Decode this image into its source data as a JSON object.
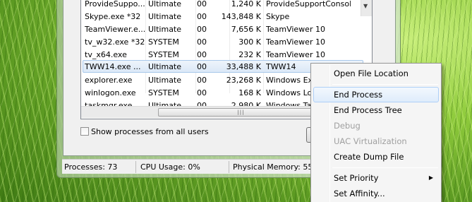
{
  "processes": [
    {
      "name": "ProvideSuppo...",
      "user": "Ultimate",
      "cpu": "00",
      "mem": "1,240 K",
      "desc": "ProvideSupportConsole"
    },
    {
      "name": "Skype.exe *32",
      "user": "Ultimate",
      "cpu": "00",
      "mem": "143,848 K",
      "desc": "Skype"
    },
    {
      "name": "TeamViewer.e...",
      "user": "Ultimate",
      "cpu": "00",
      "mem": "7,656 K",
      "desc": "TeamViewer 10"
    },
    {
      "name": "tv_w32.exe *32",
      "user": "SYSTEM",
      "cpu": "00",
      "mem": "300 K",
      "desc": "TeamViewer 10"
    },
    {
      "name": "tv_x64.exe",
      "user": "SYSTEM",
      "cpu": "00",
      "mem": "232 K",
      "desc": "TeamViewer 10"
    },
    {
      "name": "TWW14.exe ...",
      "user": "Ultimate",
      "cpu": "00",
      "mem": "33,488 K",
      "desc": "TWW14"
    },
    {
      "name": "explorer.exe",
      "user": "Ultimate",
      "cpu": "00",
      "mem": "23,268 K",
      "desc": "Windows Exp"
    },
    {
      "name": "winlogon.exe",
      "user": "SYSTEM",
      "cpu": "00",
      "mem": "168 K",
      "desc": "Windows Log"
    },
    {
      "name": "taskmgr.exe",
      "user": "Ultimate",
      "cpu": "00",
      "mem": "2,980 K",
      "desc": "Windows Tas"
    }
  ],
  "show_all_label": "Show processes from all users",
  "status": {
    "processes": "Processes: 73",
    "cpu": "CPU Usage: 0%",
    "memory": "Physical Memory: 55"
  },
  "context_menu": {
    "open_location": "Open File Location",
    "end_process": "End Process",
    "end_tree": "End Process Tree",
    "debug": "Debug",
    "uac": "UAC Virtualization",
    "dump": "Create Dump File",
    "priority": "Set Priority",
    "affinity": "Set Affinity..."
  },
  "colors": {
    "selection_border": "#a8c8ea",
    "menu_hover": "#aecff7"
  }
}
